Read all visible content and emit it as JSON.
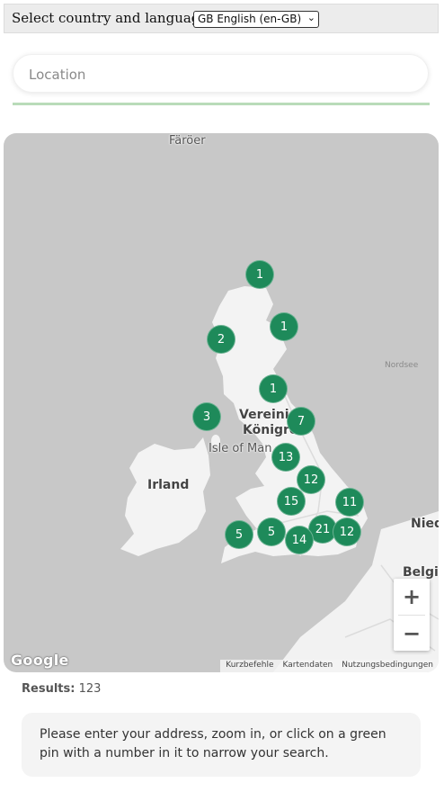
{
  "header": {
    "label": "Select country and language:",
    "selected_language": "GB English (en-GB)"
  },
  "search": {
    "placeholder": "Location",
    "value": ""
  },
  "map": {
    "labels": {
      "faroe": "Färöer",
      "north_sea": "Nordsee",
      "uk_line1": "Vereinig",
      "uk_line2": "Königre",
      "isle_of_man": "Isle of Man",
      "ireland": "Irland",
      "nied": "Nied",
      "belg": "Belgi"
    },
    "pins": [
      {
        "count": "1"
      },
      {
        "count": "1"
      },
      {
        "count": "2"
      },
      {
        "count": "1"
      },
      {
        "count": "3"
      },
      {
        "count": "7"
      },
      {
        "count": "13"
      },
      {
        "count": "12"
      },
      {
        "count": "15"
      },
      {
        "count": "11"
      },
      {
        "count": "5"
      },
      {
        "count": "5"
      },
      {
        "count": "21"
      },
      {
        "count": "12"
      },
      {
        "count": "14"
      }
    ],
    "pin_color": "#1e8a5a",
    "zoom_in_symbol": "+",
    "zoom_out_symbol": "−",
    "google_logo": "Google",
    "attribution": {
      "shortcuts": "Kurzbefehle",
      "map_data": "Kartendaten",
      "terms": "Nutzungsbedingungen"
    }
  },
  "results": {
    "label": "Results:",
    "count": "123"
  },
  "info": {
    "text": "Please enter your address, zoom in, or click on a green pin with a number in it to narrow your search."
  }
}
